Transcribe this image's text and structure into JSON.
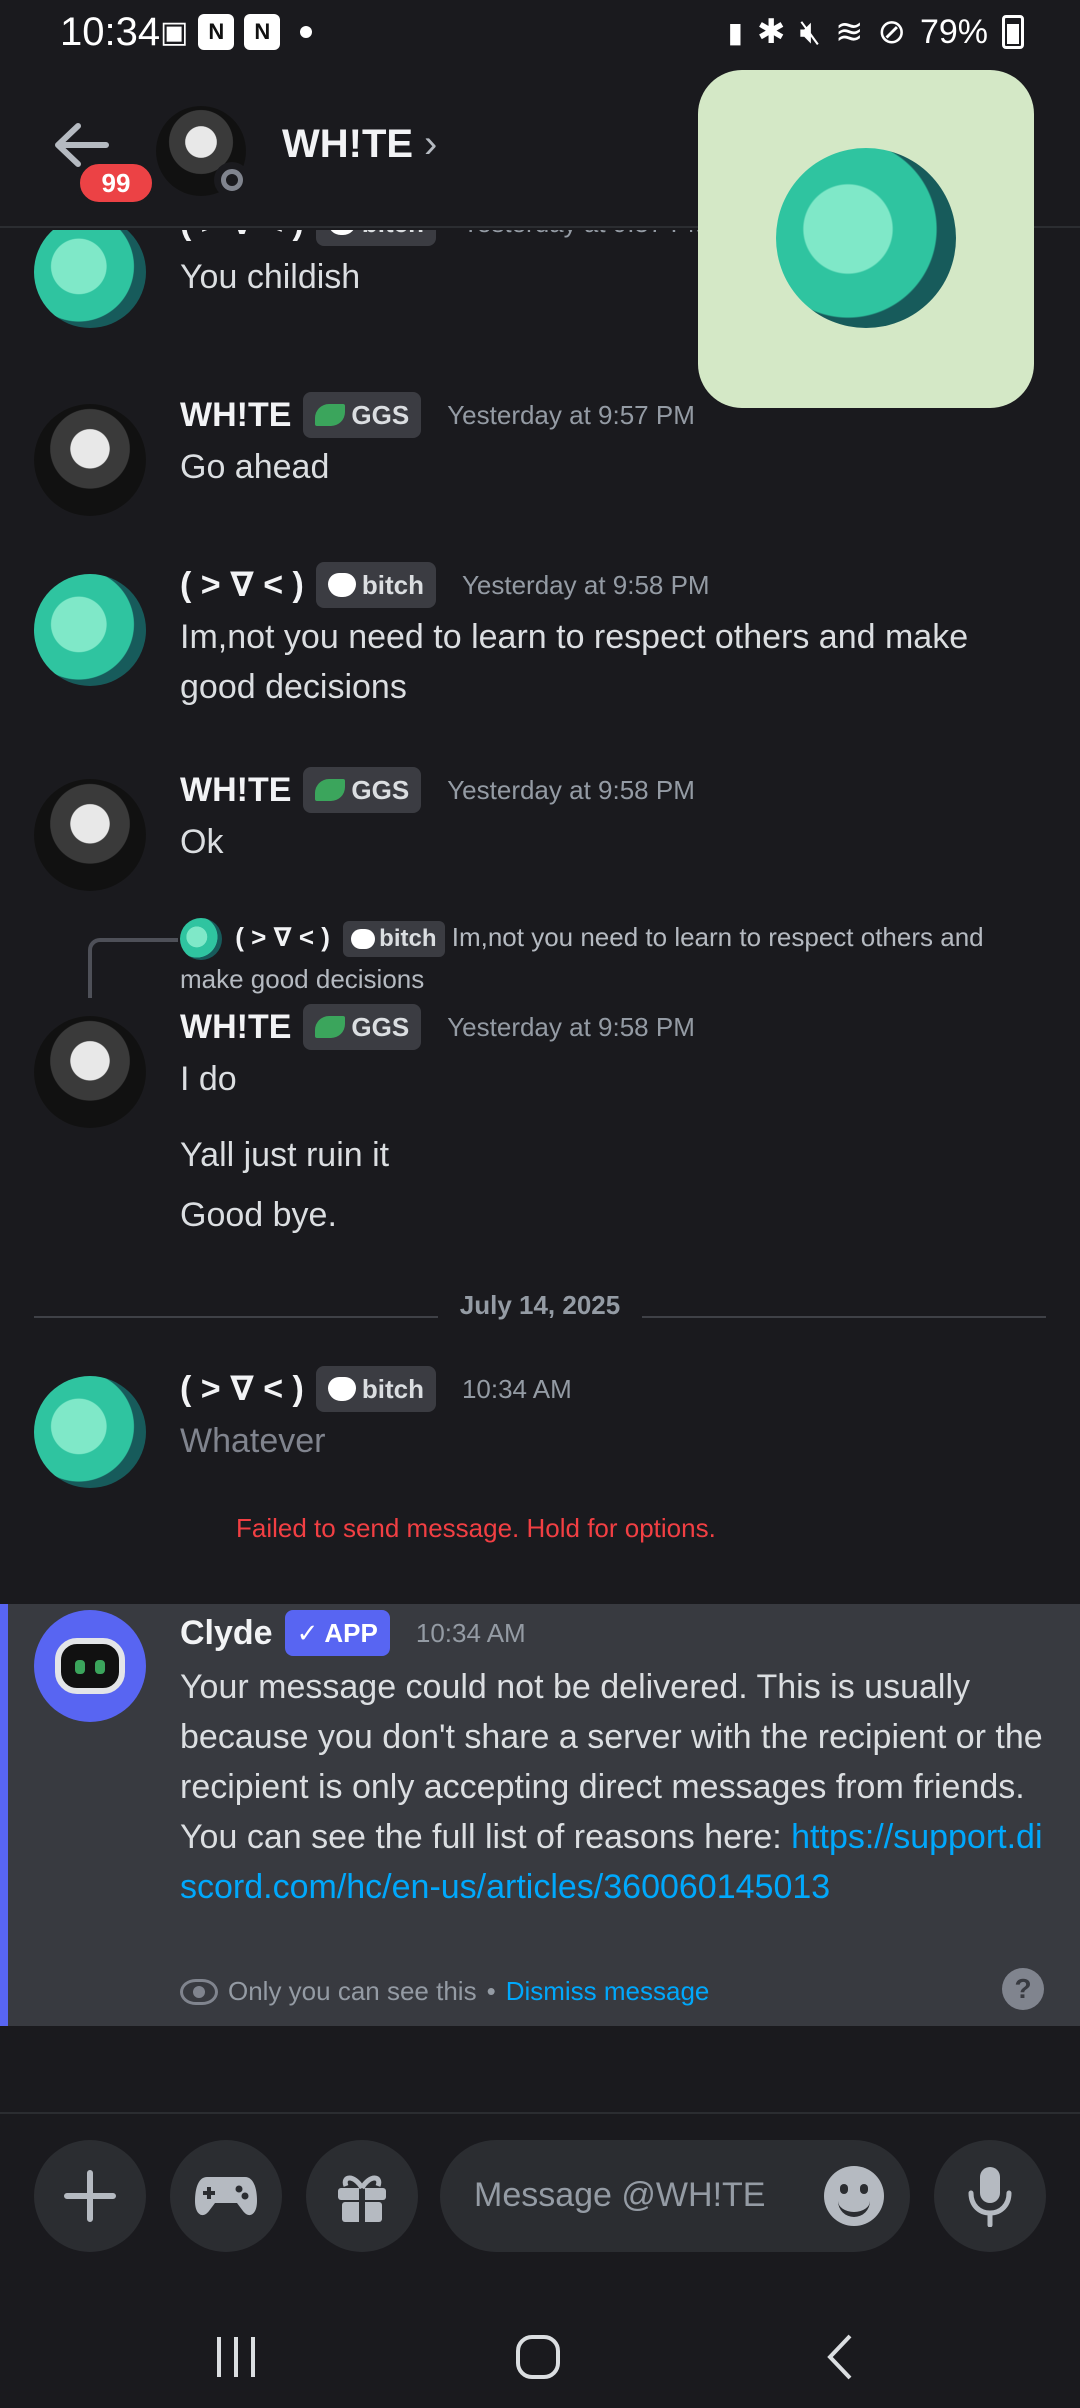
{
  "status_bar": {
    "time": "10:34",
    "battery": "79%"
  },
  "header": {
    "unread_badge": "99",
    "title": "WH!TE",
    "chevron": "›"
  },
  "messages": [
    {
      "author": "( > ∇ < )",
      "tag": "bitch",
      "timestamp": "Yesterday at 9:57 PM",
      "lines": [
        "You childish"
      ]
    },
    {
      "author": "WH!TE",
      "tag": "GGS",
      "timestamp": "Yesterday at 9:57 PM",
      "lines": [
        "Go ahead"
      ]
    },
    {
      "author": "( > ∇ < )",
      "tag": "bitch",
      "timestamp": "Yesterday at 9:58 PM",
      "lines": [
        "Im,not you need to learn to respect others and make good decisions"
      ]
    },
    {
      "author": "WH!TE",
      "tag": "GGS",
      "timestamp": "Yesterday at 9:58 PM",
      "lines": [
        "Ok"
      ]
    },
    {
      "author": "WH!TE",
      "tag": "GGS",
      "timestamp": "Yesterday at 9:58 PM",
      "reply": {
        "author": "( > ∇ < )",
        "tag": "bitch",
        "text": "Im,not you need to learn to respect others and make good decisions"
      },
      "lines": [
        "I do",
        "Yall just ruin it",
        "Good bye."
      ]
    }
  ],
  "date_divider": "July 14, 2025",
  "pending": {
    "author": "( > ∇ < )",
    "tag": "bitch",
    "timestamp": "10:34 AM",
    "text": "Whatever",
    "error": "Failed to send message. Hold for options."
  },
  "clyde": {
    "author": "Clyde",
    "app_tag": "APP",
    "timestamp": "10:34 AM",
    "text": "Your message could not be delivered. This is usually because you don't share a server with the recipient or the recipient is only accepting direct messages from friends. You can see the full list of reasons here:",
    "link": "https://support.discord.com/hc/en-us/articles/360060145013",
    "visibility": "Only you can see this",
    "separator": "•",
    "dismiss": "Dismiss message",
    "help": "?"
  },
  "composer": {
    "placeholder": "Message @WH!TE"
  },
  "colors": {
    "background": "#1a1a1e",
    "accent": "#5865f2",
    "error": "#f23f43",
    "link": "#00a8fc"
  }
}
